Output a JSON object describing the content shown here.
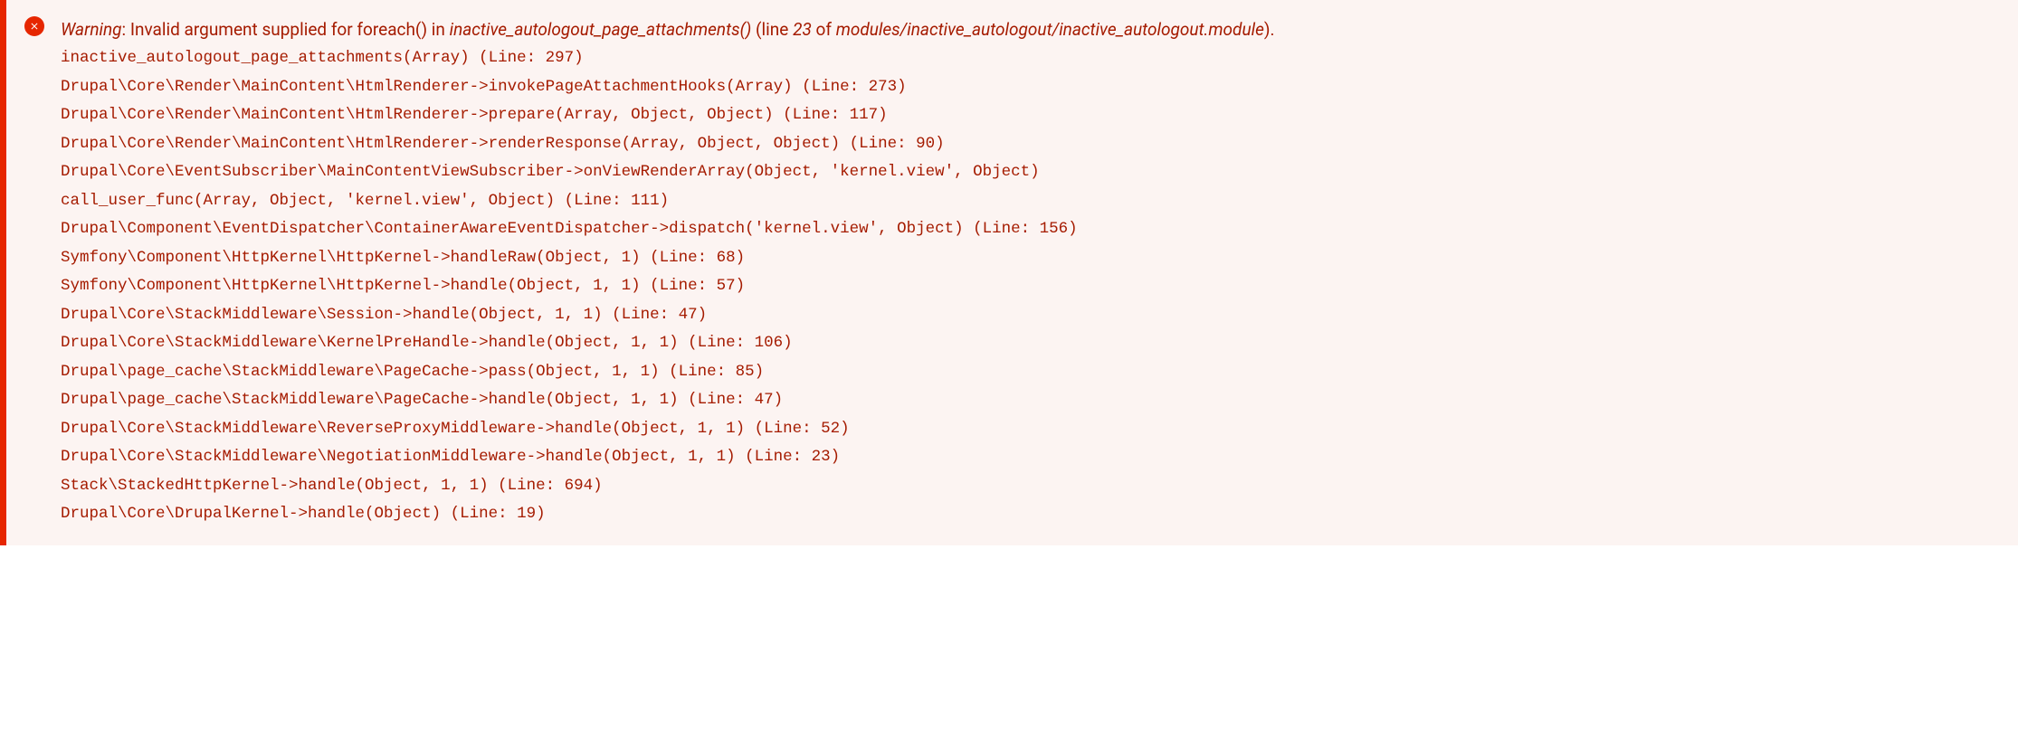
{
  "message": {
    "level": "Warning",
    "text": ": Invalid argument supplied for foreach() in ",
    "function": "inactive_autologout_page_attachments()",
    "line_prefix": " (line ",
    "line_number": "23",
    "of_text": " of ",
    "file": "modules/inactive_autologout/inactive_autologout.module",
    "closing": ")."
  },
  "stack_trace": [
    "inactive_autologout_page_attachments(Array) (Line: 297)",
    "Drupal\\Core\\Render\\MainContent\\HtmlRenderer->invokePageAttachmentHooks(Array) (Line: 273)",
    "Drupal\\Core\\Render\\MainContent\\HtmlRenderer->prepare(Array, Object, Object) (Line: 117)",
    "Drupal\\Core\\Render\\MainContent\\HtmlRenderer->renderResponse(Array, Object, Object) (Line: 90)",
    "Drupal\\Core\\EventSubscriber\\MainContentViewSubscriber->onViewRenderArray(Object, 'kernel.view', Object)",
    "call_user_func(Array, Object, 'kernel.view', Object) (Line: 111)",
    "Drupal\\Component\\EventDispatcher\\ContainerAwareEventDispatcher->dispatch('kernel.view', Object) (Line: 156)",
    "Symfony\\Component\\HttpKernel\\HttpKernel->handleRaw(Object, 1) (Line: 68)",
    "Symfony\\Component\\HttpKernel\\HttpKernel->handle(Object, 1, 1) (Line: 57)",
    "Drupal\\Core\\StackMiddleware\\Session->handle(Object, 1, 1) (Line: 47)",
    "Drupal\\Core\\StackMiddleware\\KernelPreHandle->handle(Object, 1, 1) (Line: 106)",
    "Drupal\\page_cache\\StackMiddleware\\PageCache->pass(Object, 1, 1) (Line: 85)",
    "Drupal\\page_cache\\StackMiddleware\\PageCache->handle(Object, 1, 1) (Line: 47)",
    "Drupal\\Core\\StackMiddleware\\ReverseProxyMiddleware->handle(Object, 1, 1) (Line: 52)",
    "Drupal\\Core\\StackMiddleware\\NegotiationMiddleware->handle(Object, 1, 1) (Line: 23)",
    "Stack\\StackedHttpKernel->handle(Object, 1, 1) (Line: 694)",
    "Drupal\\Core\\DrupalKernel->handle(Object) (Line: 19)"
  ]
}
